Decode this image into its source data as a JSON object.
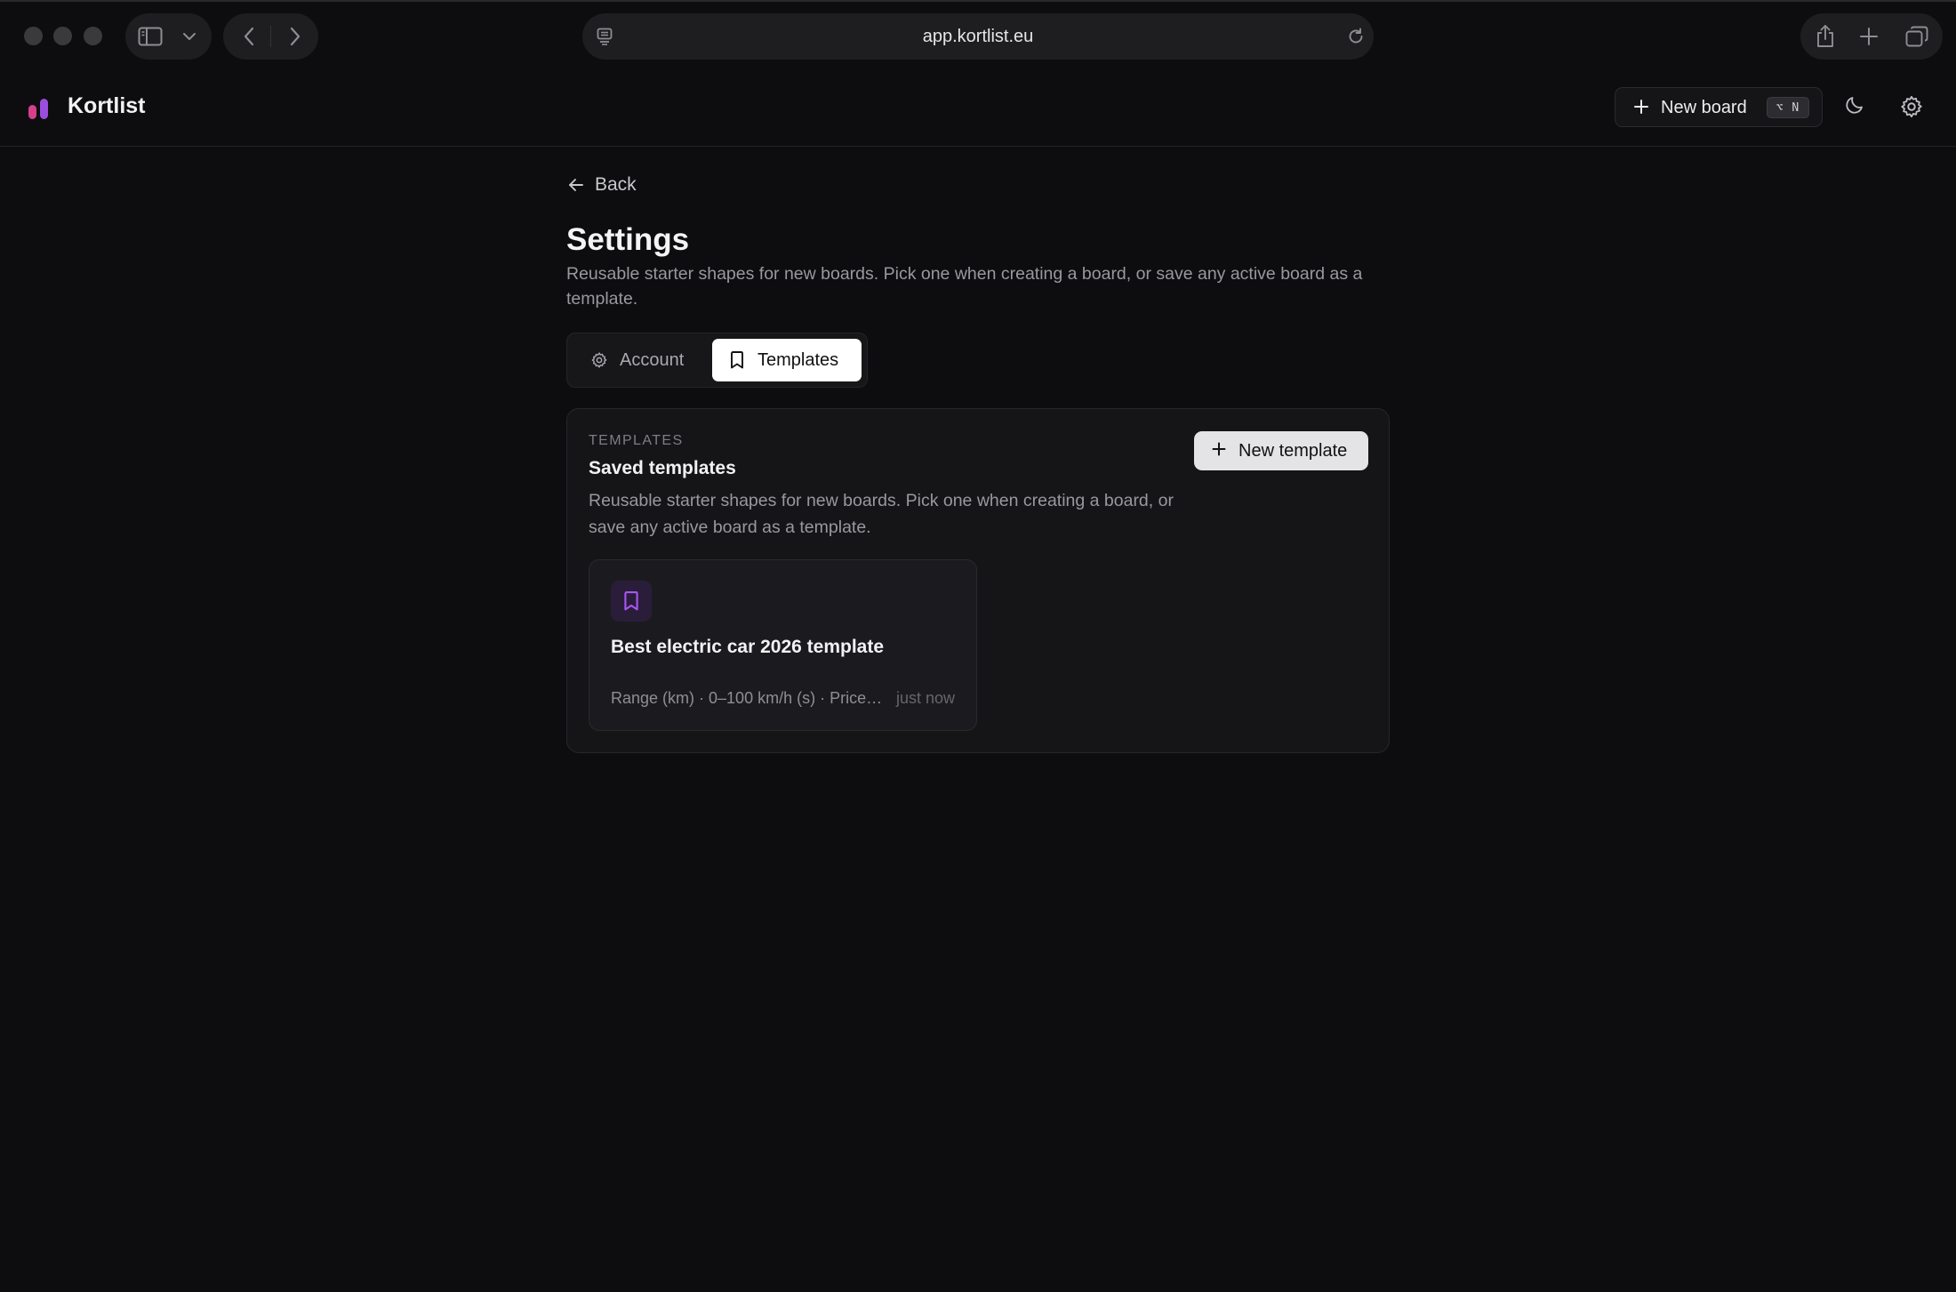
{
  "browser": {
    "url": "app.kortlist.eu"
  },
  "app": {
    "name": "Kortlist",
    "new_board_label": "New board",
    "new_board_shortcut": "⌥ N"
  },
  "page": {
    "back_label": "Back",
    "title": "Settings",
    "description": "Reusable starter shapes for new boards. Pick one when creating a board, or save any active board as a template."
  },
  "tabs": [
    {
      "label": "Account",
      "icon": "gear-icon",
      "active": false
    },
    {
      "label": "Templates",
      "icon": "bookmark-icon",
      "active": true
    }
  ],
  "templates_section": {
    "eyebrow": "TEMPLATES",
    "title": "Saved templates",
    "description": "Reusable starter shapes for new boards. Pick one when creating a board, or save any active board as a template.",
    "new_template_label": "New template",
    "items": [
      {
        "name": "Best electric car 2026 template",
        "columns": "Range (km) · 0–100 km/h (s) · Price …",
        "updated": "just now",
        "icon": "bookmark-icon",
        "accent": "#a855f7"
      }
    ]
  },
  "colors": {
    "background": "#0d0d0f",
    "logo_pink": "#d63f8c",
    "logo_purple": "#9b4de0",
    "active_tab": "#ffffff"
  }
}
